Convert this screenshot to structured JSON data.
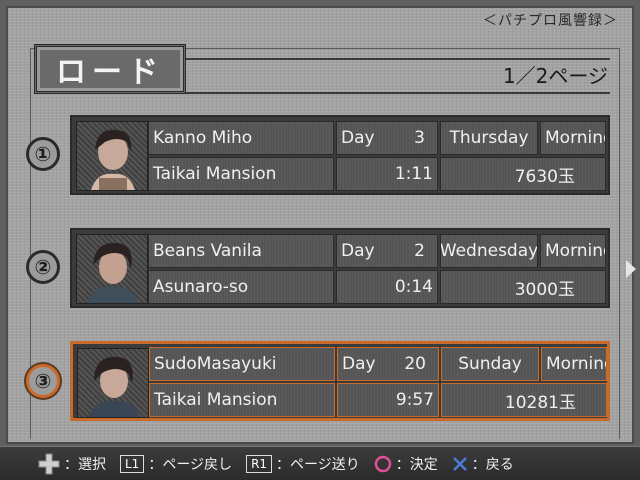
{
  "header": {
    "tag": "＜パチプロ風響録＞",
    "title": "ロード",
    "page_indicator": "1／2ページ"
  },
  "slots": [
    {
      "num": "①",
      "name": "Kanno Miho",
      "day_label": "Day",
      "day": "3",
      "weekday": "Thursday",
      "time_of_day": "Morning",
      "location": "Taikai Mansion",
      "playtime": "1:11",
      "money": "7630玉",
      "selected": false
    },
    {
      "num": "②",
      "name": "Beans Vanila",
      "day_label": "Day",
      "day": "2",
      "weekday": "Wednesday",
      "time_of_day": "Morning",
      "location": "Asunaro-so",
      "playtime": "0:14",
      "money": "3000玉",
      "selected": false
    },
    {
      "num": "③",
      "name": "SudoMasayuki",
      "day_label": "Day",
      "day": "20",
      "weekday": "Sunday",
      "time_of_day": "Morning",
      "location": "Taikai Mansion",
      "playtime": "9:57",
      "money": "10281玉",
      "selected": true
    }
  ],
  "footer": {
    "select_label": "：選択",
    "l1_key": "L1",
    "l1_label": "：ページ戻し",
    "r1_key": "R1",
    "r1_label": "：ページ送り",
    "confirm_label": "：決定",
    "back_label": "：戻る"
  },
  "colors": {
    "selected_border": "#c86a2c",
    "circle_button": "#e0509a",
    "cross_button": "#4a7ae0"
  }
}
